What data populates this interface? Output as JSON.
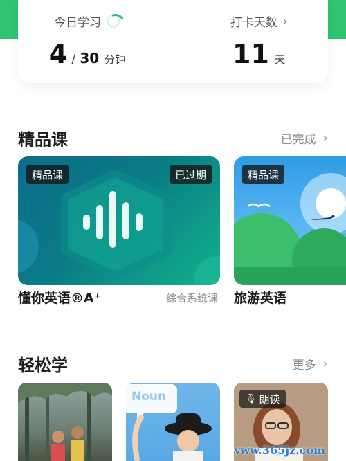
{
  "stats": {
    "today_label": "今日学习",
    "today_value": "4",
    "today_separator": "/",
    "today_goal": "30",
    "today_unit": "分钟",
    "checkin_label": "打卡天数",
    "checkin_value": "11",
    "checkin_unit": "天"
  },
  "premium": {
    "title": "精品课",
    "link": "已完成",
    "courses": [
      {
        "badge": "精品课",
        "status": "已过期",
        "name": "懂你英语®A⁺",
        "tag": "综合系统课"
      },
      {
        "badge": "精品课",
        "name": "旅游英语"
      }
    ]
  },
  "easy": {
    "title": "轻松学",
    "link": "更多",
    "cards": [
      {
        "label": ""
      },
      {
        "label": "Noun"
      },
      {
        "badge": "朗读"
      }
    ]
  },
  "watermark": "www.365jz.com",
  "colors": {
    "accent": "#2ec471",
    "text": "#1b1b1b",
    "muted": "#8a8a8a"
  }
}
